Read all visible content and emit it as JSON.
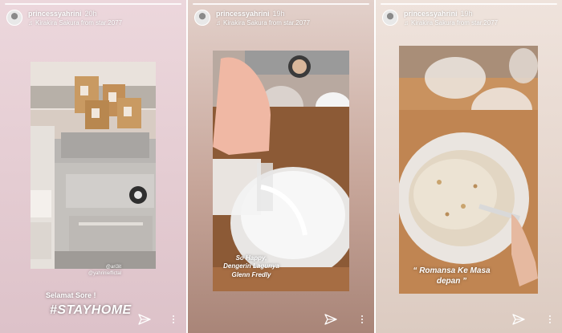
{
  "stories": [
    {
      "username": "princessyahrini",
      "time": "20h",
      "music": "Kirakira Sakura from star.2077",
      "caption_small": "@ari3it\n@yahrinieffictal",
      "caption_greeting": "Selamat Sore !",
      "caption_tag": "#STAYHOME"
    },
    {
      "username": "princessyahrini",
      "time": "19h",
      "music": "Kirakira Sakura from star.2077",
      "caption": "So Happy,\nDengerin Lagunya\nGlenn Fredly"
    },
    {
      "username": "princessyahrini",
      "time": "19h",
      "music": "Kirakira Sakura from star.2077",
      "caption": "“ Romansa Ke Masa\ndepan ”"
    }
  ],
  "icons": {
    "music": "music-note-icon",
    "send": "send-icon",
    "more": "more-vertical-icon"
  }
}
